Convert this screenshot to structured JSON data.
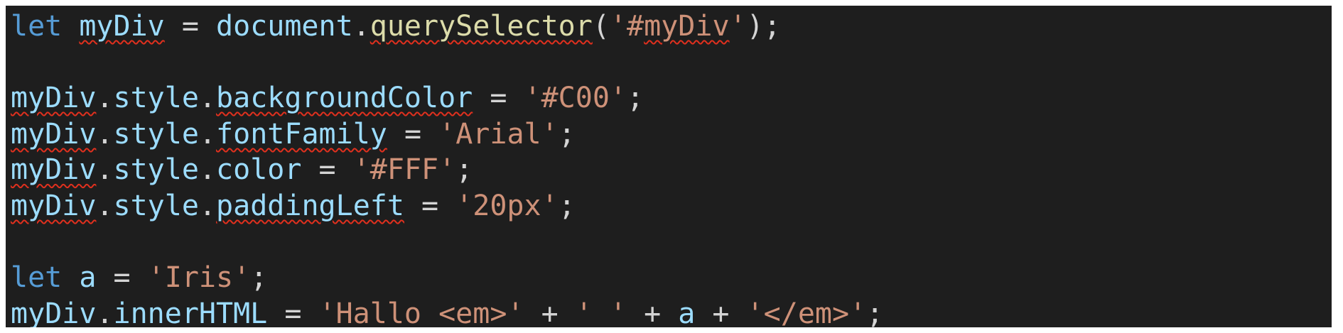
{
  "editor": {
    "colors": {
      "background": "#1e1e1e",
      "keyword": "#569cd6",
      "variable": "#9cdcfe",
      "function": "#dcdcaa",
      "string": "#ce9178",
      "operator": "#d4d4d4",
      "spellcheck_underline": "#e0301e"
    },
    "lines": [
      {
        "tokens": [
          {
            "text": "let",
            "type": "keyword"
          },
          {
            "text": " "
          },
          {
            "text": "myDiv",
            "type": "variable",
            "squiggle": true
          },
          {
            "text": " = ",
            "type": "operator"
          },
          {
            "text": "document",
            "type": "variable"
          },
          {
            "text": ".",
            "type": "punct"
          },
          {
            "text": "querySelector",
            "type": "function",
            "squiggle": true
          },
          {
            "text": "(",
            "type": "punct"
          },
          {
            "text": "'#",
            "type": "string"
          },
          {
            "text": "myDiv",
            "type": "string",
            "squiggle": true
          },
          {
            "text": "'",
            "type": "string"
          },
          {
            "text": ");",
            "type": "punct"
          }
        ]
      },
      {
        "tokens": []
      },
      {
        "tokens": [
          {
            "text": "myDiv",
            "type": "variable",
            "squiggle": true
          },
          {
            "text": ".",
            "type": "punct"
          },
          {
            "text": "style",
            "type": "variable"
          },
          {
            "text": ".",
            "type": "punct"
          },
          {
            "text": "backgroundColor",
            "type": "variable",
            "squiggle": true
          },
          {
            "text": " = ",
            "type": "operator"
          },
          {
            "text": "'#C00'",
            "type": "string"
          },
          {
            "text": ";",
            "type": "punct"
          }
        ]
      },
      {
        "tokens": [
          {
            "text": "myDiv",
            "type": "variable",
            "squiggle": true
          },
          {
            "text": ".",
            "type": "punct"
          },
          {
            "text": "style",
            "type": "variable"
          },
          {
            "text": ".",
            "type": "punct"
          },
          {
            "text": "fontFamily",
            "type": "variable",
            "squiggle": true
          },
          {
            "text": " = ",
            "type": "operator"
          },
          {
            "text": "'Arial'",
            "type": "string"
          },
          {
            "text": ";",
            "type": "punct"
          }
        ]
      },
      {
        "tokens": [
          {
            "text": "myDiv",
            "type": "variable",
            "squiggle": true
          },
          {
            "text": ".",
            "type": "punct"
          },
          {
            "text": "style",
            "type": "variable"
          },
          {
            "text": ".",
            "type": "punct"
          },
          {
            "text": "color",
            "type": "variable"
          },
          {
            "text": " = ",
            "type": "operator"
          },
          {
            "text": "'#FFF'",
            "type": "string"
          },
          {
            "text": ";",
            "type": "punct"
          }
        ]
      },
      {
        "tokens": [
          {
            "text": "myDiv",
            "type": "variable",
            "squiggle": true
          },
          {
            "text": ".",
            "type": "punct"
          },
          {
            "text": "style",
            "type": "variable"
          },
          {
            "text": ".",
            "type": "punct"
          },
          {
            "text": "paddingLeft",
            "type": "variable",
            "squiggle": true
          },
          {
            "text": " = ",
            "type": "operator"
          },
          {
            "text": "'20px'",
            "type": "string"
          },
          {
            "text": ";",
            "type": "punct"
          }
        ]
      },
      {
        "tokens": []
      },
      {
        "tokens": [
          {
            "text": "let",
            "type": "keyword"
          },
          {
            "text": " "
          },
          {
            "text": "a",
            "type": "variable"
          },
          {
            "text": " = ",
            "type": "operator"
          },
          {
            "text": "'Iris'",
            "type": "string"
          },
          {
            "text": ";",
            "type": "punct"
          }
        ]
      },
      {
        "tokens": [
          {
            "text": "myDiv",
            "type": "variable",
            "squiggle": true
          },
          {
            "text": ".",
            "type": "punct"
          },
          {
            "text": "innerHTML",
            "type": "variable",
            "squiggle": true
          },
          {
            "text": " = ",
            "type": "operator"
          },
          {
            "text": "'Hallo <em>'",
            "type": "string"
          },
          {
            "text": " + ",
            "type": "operator"
          },
          {
            "text": "' '",
            "type": "string"
          },
          {
            "text": " + ",
            "type": "operator"
          },
          {
            "text": "a",
            "type": "variable"
          },
          {
            "text": " + ",
            "type": "operator"
          },
          {
            "text": "'</em>'",
            "type": "string"
          },
          {
            "text": ";",
            "type": "punct"
          }
        ]
      }
    ]
  }
}
